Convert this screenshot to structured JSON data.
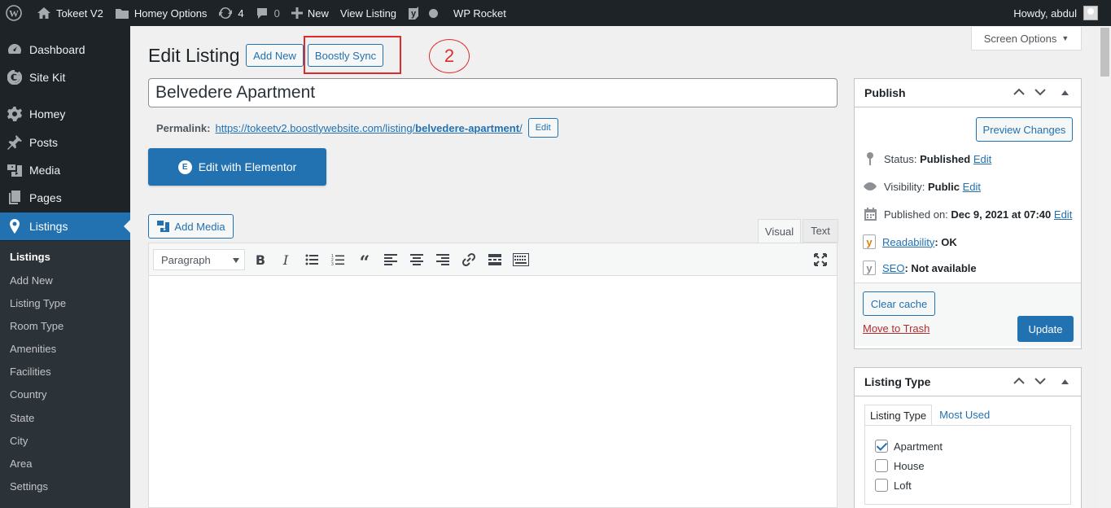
{
  "admin_bar": {
    "site_name": "Tokeet V2",
    "homey_options": "Homey Options",
    "updates_count": "4",
    "comments_count": "0",
    "new_label": "New",
    "view_listing": "View Listing",
    "wp_rocket": "WP Rocket",
    "howdy": "Howdy, abdul"
  },
  "sidebar": {
    "items": [
      {
        "label": "Dashboard",
        "icon": "dashboard-icon"
      },
      {
        "label": "Site Kit",
        "icon": "google-g-icon"
      },
      {
        "label": "Homey",
        "icon": "gear-icon"
      },
      {
        "label": "Posts",
        "icon": "pushpin-icon"
      },
      {
        "label": "Media",
        "icon": "media-icon"
      },
      {
        "label": "Pages",
        "icon": "pages-icon"
      },
      {
        "label": "Listings",
        "icon": "location-pin-icon"
      }
    ],
    "submenu": [
      "Listings",
      "Add New",
      "Listing Type",
      "Room Type",
      "Amenities",
      "Facilities",
      "Country",
      "State",
      "City",
      "Area",
      "Settings"
    ]
  },
  "header": {
    "screen_options": "Screen Options",
    "page_title": "Edit Listing",
    "add_new": "Add New",
    "boostly_sync": "Boostly Sync",
    "annotation_number": "2"
  },
  "post": {
    "title": "Belvedere Apartment",
    "permalink_label": "Permalink:",
    "permalink_base": "https://tokeetv2.boostlywebsite.com/listing/",
    "permalink_slug": "belvedere-apartment",
    "permalink_trailing": "/",
    "permalink_edit": "Edit",
    "elementor_button": "Edit with Elementor"
  },
  "editor": {
    "add_media": "Add Media",
    "tab_visual": "Visual",
    "tab_text": "Text",
    "format_select": "Paragraph"
  },
  "publish": {
    "title": "Publish",
    "preview_changes": "Preview Changes",
    "status_label": "Status:",
    "status_value": "Published",
    "visibility_label": "Visibility:",
    "visibility_value": "Public",
    "published_on_label": "Published on:",
    "published_on_value": "Dec 9, 2021 at 07:40",
    "edit_link": "Edit",
    "readability_link": "Readability",
    "readability_value": ": OK",
    "seo_link": "SEO",
    "seo_value": ": Not available",
    "clear_cache": "Clear cache",
    "move_to_trash": "Move to Trash",
    "update": "Update"
  },
  "listing_type": {
    "title": "Listing Type",
    "tab_all": "Listing Type",
    "tab_most_used": "Most Used",
    "options": [
      {
        "label": "Apartment",
        "checked": true
      },
      {
        "label": "House",
        "checked": false
      },
      {
        "label": "Loft",
        "checked": false
      }
    ]
  },
  "colors": {
    "accent": "#2271b1",
    "admin_dark": "#1d2327",
    "annotation_red": "#e02b2b",
    "trash_red": "#b32d2e",
    "yoast_orange": "#e17c15"
  }
}
